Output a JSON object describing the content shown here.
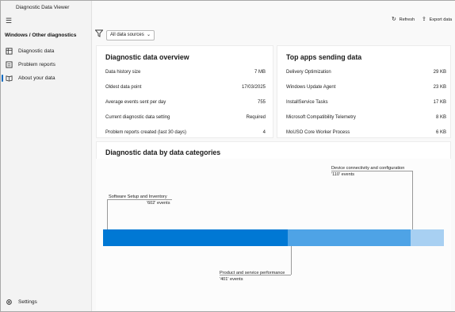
{
  "app": {
    "title": "Diagnostic Data Viewer"
  },
  "window_controls": {
    "minimize": "—",
    "maximize": "☐",
    "close": "✕"
  },
  "sidebar": {
    "header": "Windows / Other diagnostics",
    "items": [
      {
        "label": "Diagnostic data",
        "icon": "database-icon"
      },
      {
        "label": "Problem reports",
        "icon": "report-icon"
      },
      {
        "label": "About your data",
        "icon": "book-icon"
      }
    ],
    "settings_label": "Settings"
  },
  "toolbar": {
    "refresh_label": "Refresh",
    "export_label": "Export data"
  },
  "filter": {
    "selected": "All data sources"
  },
  "overview": {
    "title": "Diagnostic data overview",
    "rows": [
      {
        "label": "Data history size",
        "value": "7 MB"
      },
      {
        "label": "Oldest data point",
        "value": "17/03/2025"
      },
      {
        "label": "Average events sent per day",
        "value": "755"
      },
      {
        "label": "Current diagnostic data setting",
        "value": "Required"
      },
      {
        "label": "Problem reports created (last 30 days)",
        "value": "4"
      }
    ]
  },
  "top_apps": {
    "title": "Top apps sending data",
    "rows": [
      {
        "label": "Delivery Optimization",
        "value": "29 KB"
      },
      {
        "label": "Windows Update Agent",
        "value": "23 KB"
      },
      {
        "label": "InstallService Tasks",
        "value": "17 KB"
      },
      {
        "label": "Microsoft Compatibility Telemetry",
        "value": "8 KB"
      },
      {
        "label": "MoUSO Core Worker Process",
        "value": "6 KB"
      }
    ]
  },
  "categories": {
    "title": "Diagnostic data by data categories",
    "segments": [
      {
        "name": "Software Setup and Inventory",
        "events_text": "'602' events",
        "events": 602,
        "color": "#0078d4"
      },
      {
        "name": "Product and service performance",
        "events_text": "'401' events",
        "events": 401,
        "color": "#4ea3e6"
      },
      {
        "name": "Device connectivity and configuration",
        "events_text": "'110' events",
        "events": 110,
        "color": "#a8d0f2"
      }
    ]
  }
}
